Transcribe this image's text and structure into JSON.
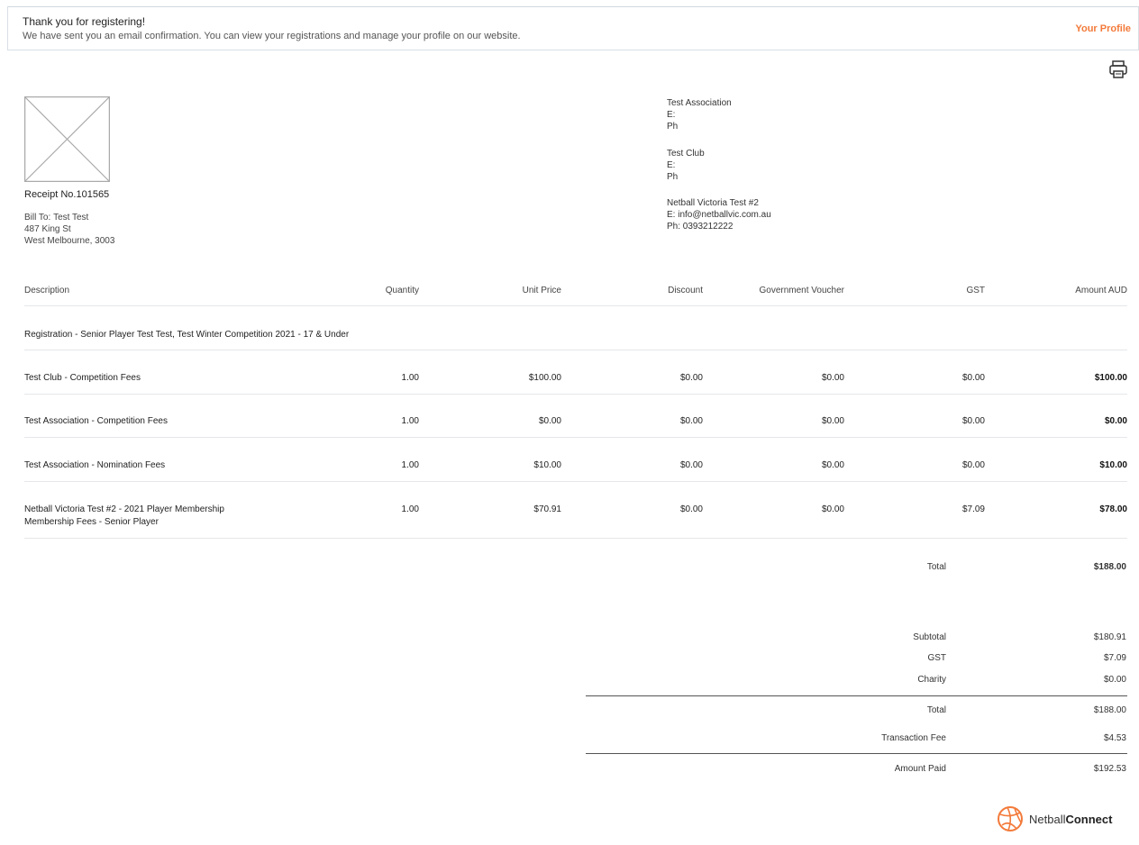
{
  "banner": {
    "title": "Thank you for registering!",
    "message": "We have sent you an email confirmation. You can view your registrations and manage your profile on our website.",
    "profile_link": "Your Profile"
  },
  "receipt": {
    "number": "Receipt No.101565",
    "bill_to_label": "Bill To:",
    "bill_to_name": "Test Test",
    "address1": "487 King St",
    "address2": "West Melbourne, 3003"
  },
  "orgs": [
    {
      "name": "Test Association",
      "email": "E:",
      "phone": "Ph"
    },
    {
      "name": "Test Club",
      "email": "E:",
      "phone": "Ph"
    },
    {
      "name": "Netball Victoria Test #2",
      "email": "E:  info@netballvic.com.au",
      "phone": "Ph:  0393212222"
    }
  ],
  "table": {
    "headers": [
      "Description",
      "Quantity",
      "Unit Price",
      "Discount",
      "Government Voucher",
      "GST",
      "Amount AUD"
    ],
    "section_title": "Registration - Senior Player Test Test, Test Winter Competition 2021 - 17 & Under",
    "rows": [
      {
        "desc": "Test Club - Competition Fees",
        "desc2": "",
        "qty": "1.00",
        "unit": "$100.00",
        "discount": "$0.00",
        "voucher": "$0.00",
        "gst": "$0.00",
        "amount": "$100.00"
      },
      {
        "desc": "Test Association - Competition Fees",
        "desc2": "",
        "qty": "1.00",
        "unit": "$0.00",
        "discount": "$0.00",
        "voucher": "$0.00",
        "gst": "$0.00",
        "amount": "$0.00"
      },
      {
        "desc": "Test Association - Nomination Fees",
        "desc2": "",
        "qty": "1.00",
        "unit": "$10.00",
        "discount": "$0.00",
        "voucher": "$0.00",
        "gst": "$0.00",
        "amount": "$10.00"
      },
      {
        "desc": "Netball Victoria Test #2 - 2021 Player Membership",
        "desc2": "Membership Fees - Senior Player",
        "qty": "1.00",
        "unit": "$70.91",
        "discount": "$0.00",
        "voucher": "$0.00",
        "gst": "$7.09",
        "amount": "$78.00"
      }
    ],
    "total_label": "Total",
    "total_value": "$188.00"
  },
  "summary": {
    "subtotal_label": "Subtotal",
    "subtotal": "$180.91",
    "gst_label": "GST",
    "gst": "$7.09",
    "charity_label": "Charity",
    "charity": "$0.00",
    "total_label": "Total",
    "total": "$188.00",
    "fee_label": "Transaction Fee",
    "fee": "$4.53",
    "paid_label": "Amount Paid",
    "paid": "$192.53"
  },
  "brand": {
    "prefix": "Netball",
    "suffix": "Connect",
    "color": "#f37a3a"
  }
}
